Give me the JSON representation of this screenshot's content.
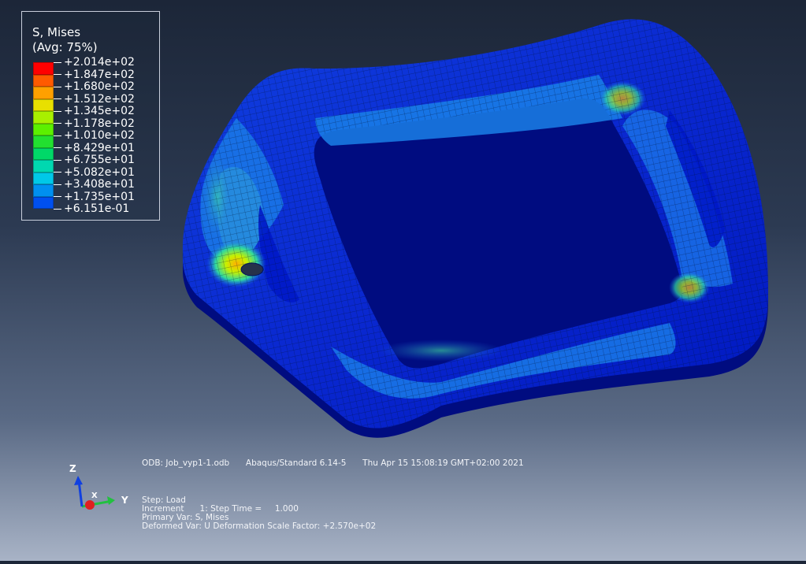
{
  "legend": {
    "title": "S, Mises",
    "subtitle": "(Avg: 75%)",
    "values": [
      "+2.014e+02",
      "+1.847e+02",
      "+1.680e+02",
      "+1.512e+02",
      "+1.345e+02",
      "+1.178e+02",
      "+1.010e+02",
      "+8.429e+01",
      "+6.755e+01",
      "+5.082e+01",
      "+3.408e+01",
      "+1.735e+01",
      "+6.151e-01"
    ],
    "colors": [
      "#ff0000",
      "#ff5a00",
      "#ffa000",
      "#e8e000",
      "#a8f000",
      "#5cf000",
      "#22e030",
      "#00d868",
      "#00d8b0",
      "#00c8e8",
      "#0090f0",
      "#0050f0",
      "#0000e0"
    ]
  },
  "info_bar": {
    "odb": "ODB: Job_vyp1-1.odb",
    "solver": "Abaqus/Standard 6.14-5",
    "date": "Thu Apr 15 15:08:19 GMT+02:00 2021"
  },
  "step_info": {
    "step": "Step: Load",
    "increment": "Increment      1: Step Time =     1.000",
    "primary_var": "Primary Var: S, Mises",
    "deformed_var": "Deformed Var: U   Deformation Scale Factor: +2.570e+02"
  },
  "triad": {
    "z": "Z",
    "y": "Y",
    "x": "X"
  },
  "colors": {
    "mesh_low": "#0000d8",
    "mesh_mid": "#1a6ae8",
    "mesh_high": "#2ac8a8",
    "hot": "#ffd000",
    "background_top": "#1c2638",
    "background_bottom": "#a8b3c6"
  }
}
